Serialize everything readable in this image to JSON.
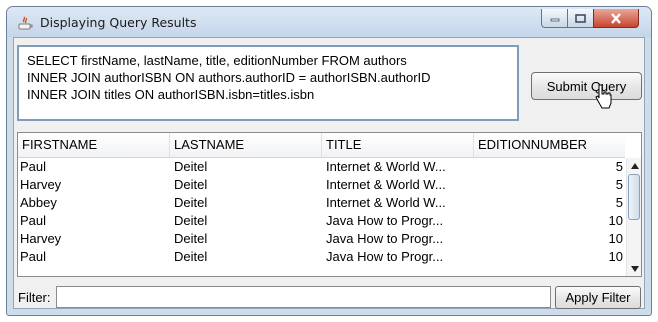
{
  "window": {
    "title": "Displaying Query Results",
    "controls": {
      "minimize": "minimize",
      "maximize": "maximize",
      "close": "close"
    }
  },
  "query": {
    "text": "SELECT firstName, lastName, title, editionNumber FROM authors\nINNER JOIN authorISBN ON authors.authorID = authorISBN.authorID\nINNER JOIN titles ON authorISBN.isbn=titles.isbn"
  },
  "submit_label": "Submit Query",
  "table": {
    "columns": [
      "FIRSTNAME",
      "LASTNAME",
      "TITLE",
      "EDITIONNUMBER"
    ],
    "rows": [
      [
        "Paul",
        "Deitel",
        "Internet & World W...",
        "5"
      ],
      [
        "Harvey",
        "Deitel",
        "Internet & World W...",
        "5"
      ],
      [
        "Abbey",
        "Deitel",
        "Internet & World W...",
        "5"
      ],
      [
        "Paul",
        "Deitel",
        "Java How to Progr...",
        "10"
      ],
      [
        "Harvey",
        "Deitel",
        "Java How to Progr...",
        "10"
      ],
      [
        "Paul",
        "Deitel",
        "Java How to Progr...",
        "10"
      ]
    ]
  },
  "filter": {
    "label": "Filter:",
    "value": ""
  },
  "apply_label": "Apply Filter",
  "colors": {
    "titlebar": "#c5d6ea",
    "close": "#c7452f",
    "query_border": "#7f9db9"
  },
  "icons": [
    "java-app-icon",
    "minimize-icon",
    "maximize-icon",
    "close-icon",
    "scroll-up-icon",
    "scroll-down-icon",
    "pointer-cursor-icon"
  ]
}
